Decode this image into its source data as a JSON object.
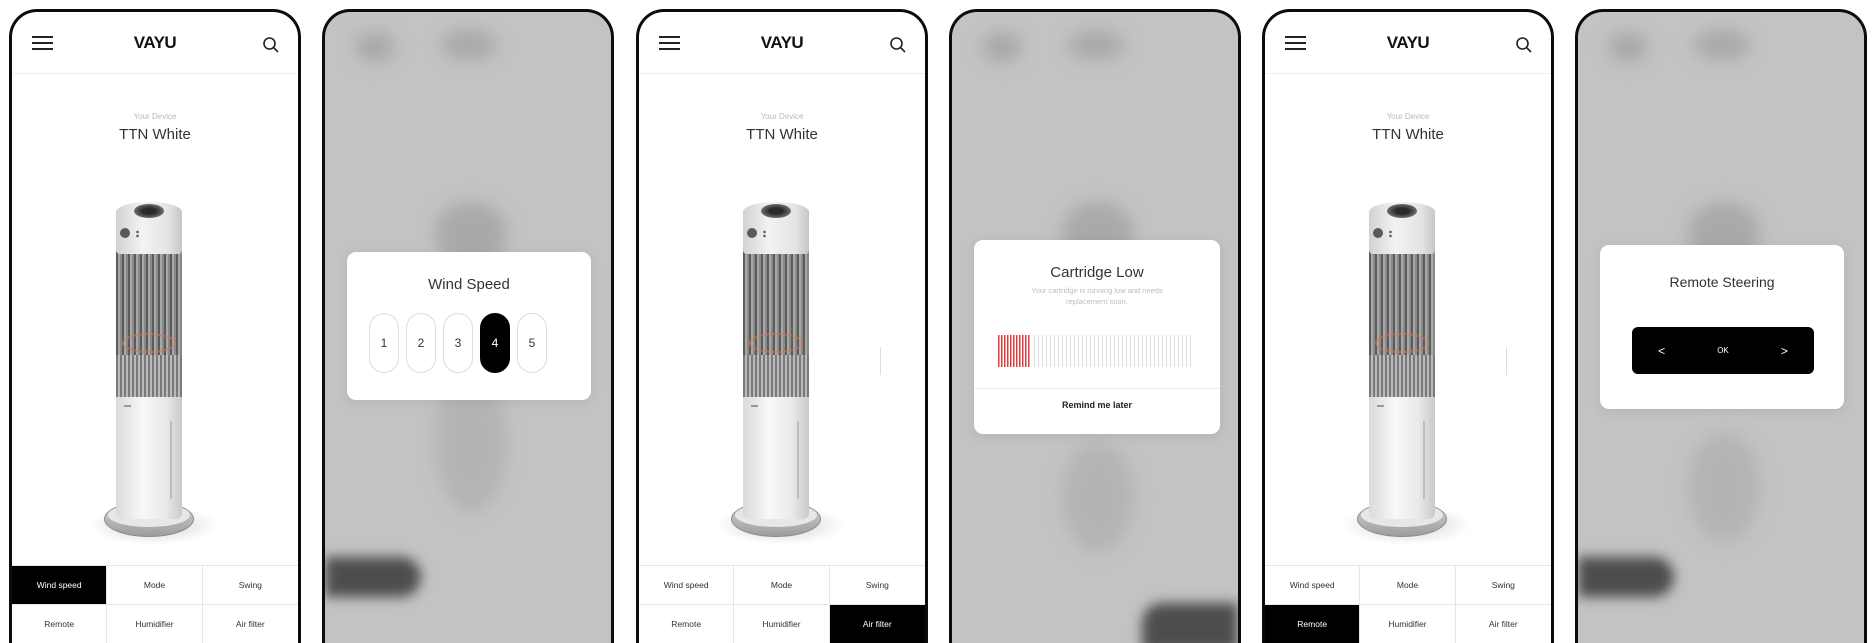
{
  "app": {
    "logo": "VAYU"
  },
  "device": {
    "label": "Your Device",
    "name": "TTN White"
  },
  "controls": [
    {
      "label": "Wind speed"
    },
    {
      "label": "Mode"
    },
    {
      "label": "Swing"
    },
    {
      "label": "Remote"
    },
    {
      "label": "Humidifier"
    },
    {
      "label": "Air filter"
    }
  ],
  "screens": {
    "screen1": {
      "active_control": "Wind speed"
    },
    "screen3": {
      "active_control": "Air filter"
    },
    "screen5": {
      "active_control": "Remote"
    }
  },
  "wind_modal": {
    "title": "Wind Speed",
    "speeds": [
      "1",
      "2",
      "3",
      "4",
      "5"
    ],
    "selected": "4"
  },
  "cartridge_modal": {
    "title": "Cartridge Low",
    "message": "Your cartridge is running low and needs replacement soon.",
    "level_percent": 17,
    "action": "Remind me later"
  },
  "remote_modal": {
    "title": "Remote Steering",
    "left": "<",
    "ok": "OK",
    "right": ">"
  },
  "colors": {
    "accent": "#000000",
    "alert": "#e23b3b",
    "overlay": "#c3c3c3"
  }
}
